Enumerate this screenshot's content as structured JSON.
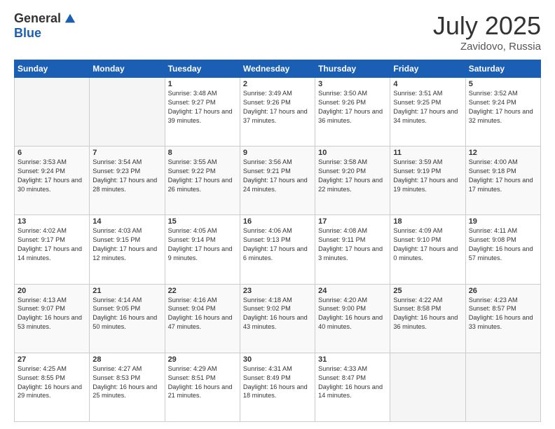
{
  "logo": {
    "general": "General",
    "blue": "Blue"
  },
  "title": {
    "month": "July 2025",
    "location": "Zavidovo, Russia"
  },
  "days_of_week": [
    "Sunday",
    "Monday",
    "Tuesday",
    "Wednesday",
    "Thursday",
    "Friday",
    "Saturday"
  ],
  "weeks": [
    [
      {
        "day": "",
        "info": ""
      },
      {
        "day": "",
        "info": ""
      },
      {
        "day": "1",
        "info": "Sunrise: 3:48 AM\nSunset: 9:27 PM\nDaylight: 17 hours and 39 minutes."
      },
      {
        "day": "2",
        "info": "Sunrise: 3:49 AM\nSunset: 9:26 PM\nDaylight: 17 hours and 37 minutes."
      },
      {
        "day": "3",
        "info": "Sunrise: 3:50 AM\nSunset: 9:26 PM\nDaylight: 17 hours and 36 minutes."
      },
      {
        "day": "4",
        "info": "Sunrise: 3:51 AM\nSunset: 9:25 PM\nDaylight: 17 hours and 34 minutes."
      },
      {
        "day": "5",
        "info": "Sunrise: 3:52 AM\nSunset: 9:24 PM\nDaylight: 17 hours and 32 minutes."
      }
    ],
    [
      {
        "day": "6",
        "info": "Sunrise: 3:53 AM\nSunset: 9:24 PM\nDaylight: 17 hours and 30 minutes."
      },
      {
        "day": "7",
        "info": "Sunrise: 3:54 AM\nSunset: 9:23 PM\nDaylight: 17 hours and 28 minutes."
      },
      {
        "day": "8",
        "info": "Sunrise: 3:55 AM\nSunset: 9:22 PM\nDaylight: 17 hours and 26 minutes."
      },
      {
        "day": "9",
        "info": "Sunrise: 3:56 AM\nSunset: 9:21 PM\nDaylight: 17 hours and 24 minutes."
      },
      {
        "day": "10",
        "info": "Sunrise: 3:58 AM\nSunset: 9:20 PM\nDaylight: 17 hours and 22 minutes."
      },
      {
        "day": "11",
        "info": "Sunrise: 3:59 AM\nSunset: 9:19 PM\nDaylight: 17 hours and 19 minutes."
      },
      {
        "day": "12",
        "info": "Sunrise: 4:00 AM\nSunset: 9:18 PM\nDaylight: 17 hours and 17 minutes."
      }
    ],
    [
      {
        "day": "13",
        "info": "Sunrise: 4:02 AM\nSunset: 9:17 PM\nDaylight: 17 hours and 14 minutes."
      },
      {
        "day": "14",
        "info": "Sunrise: 4:03 AM\nSunset: 9:15 PM\nDaylight: 17 hours and 12 minutes."
      },
      {
        "day": "15",
        "info": "Sunrise: 4:05 AM\nSunset: 9:14 PM\nDaylight: 17 hours and 9 minutes."
      },
      {
        "day": "16",
        "info": "Sunrise: 4:06 AM\nSunset: 9:13 PM\nDaylight: 17 hours and 6 minutes."
      },
      {
        "day": "17",
        "info": "Sunrise: 4:08 AM\nSunset: 9:11 PM\nDaylight: 17 hours and 3 minutes."
      },
      {
        "day": "18",
        "info": "Sunrise: 4:09 AM\nSunset: 9:10 PM\nDaylight: 17 hours and 0 minutes."
      },
      {
        "day": "19",
        "info": "Sunrise: 4:11 AM\nSunset: 9:08 PM\nDaylight: 16 hours and 57 minutes."
      }
    ],
    [
      {
        "day": "20",
        "info": "Sunrise: 4:13 AM\nSunset: 9:07 PM\nDaylight: 16 hours and 53 minutes."
      },
      {
        "day": "21",
        "info": "Sunrise: 4:14 AM\nSunset: 9:05 PM\nDaylight: 16 hours and 50 minutes."
      },
      {
        "day": "22",
        "info": "Sunrise: 4:16 AM\nSunset: 9:04 PM\nDaylight: 16 hours and 47 minutes."
      },
      {
        "day": "23",
        "info": "Sunrise: 4:18 AM\nSunset: 9:02 PM\nDaylight: 16 hours and 43 minutes."
      },
      {
        "day": "24",
        "info": "Sunrise: 4:20 AM\nSunset: 9:00 PM\nDaylight: 16 hours and 40 minutes."
      },
      {
        "day": "25",
        "info": "Sunrise: 4:22 AM\nSunset: 8:58 PM\nDaylight: 16 hours and 36 minutes."
      },
      {
        "day": "26",
        "info": "Sunrise: 4:23 AM\nSunset: 8:57 PM\nDaylight: 16 hours and 33 minutes."
      }
    ],
    [
      {
        "day": "27",
        "info": "Sunrise: 4:25 AM\nSunset: 8:55 PM\nDaylight: 16 hours and 29 minutes."
      },
      {
        "day": "28",
        "info": "Sunrise: 4:27 AM\nSunset: 8:53 PM\nDaylight: 16 hours and 25 minutes."
      },
      {
        "day": "29",
        "info": "Sunrise: 4:29 AM\nSunset: 8:51 PM\nDaylight: 16 hours and 21 minutes."
      },
      {
        "day": "30",
        "info": "Sunrise: 4:31 AM\nSunset: 8:49 PM\nDaylight: 16 hours and 18 minutes."
      },
      {
        "day": "31",
        "info": "Sunrise: 4:33 AM\nSunset: 8:47 PM\nDaylight: 16 hours and 14 minutes."
      },
      {
        "day": "",
        "info": ""
      },
      {
        "day": "",
        "info": ""
      }
    ]
  ]
}
